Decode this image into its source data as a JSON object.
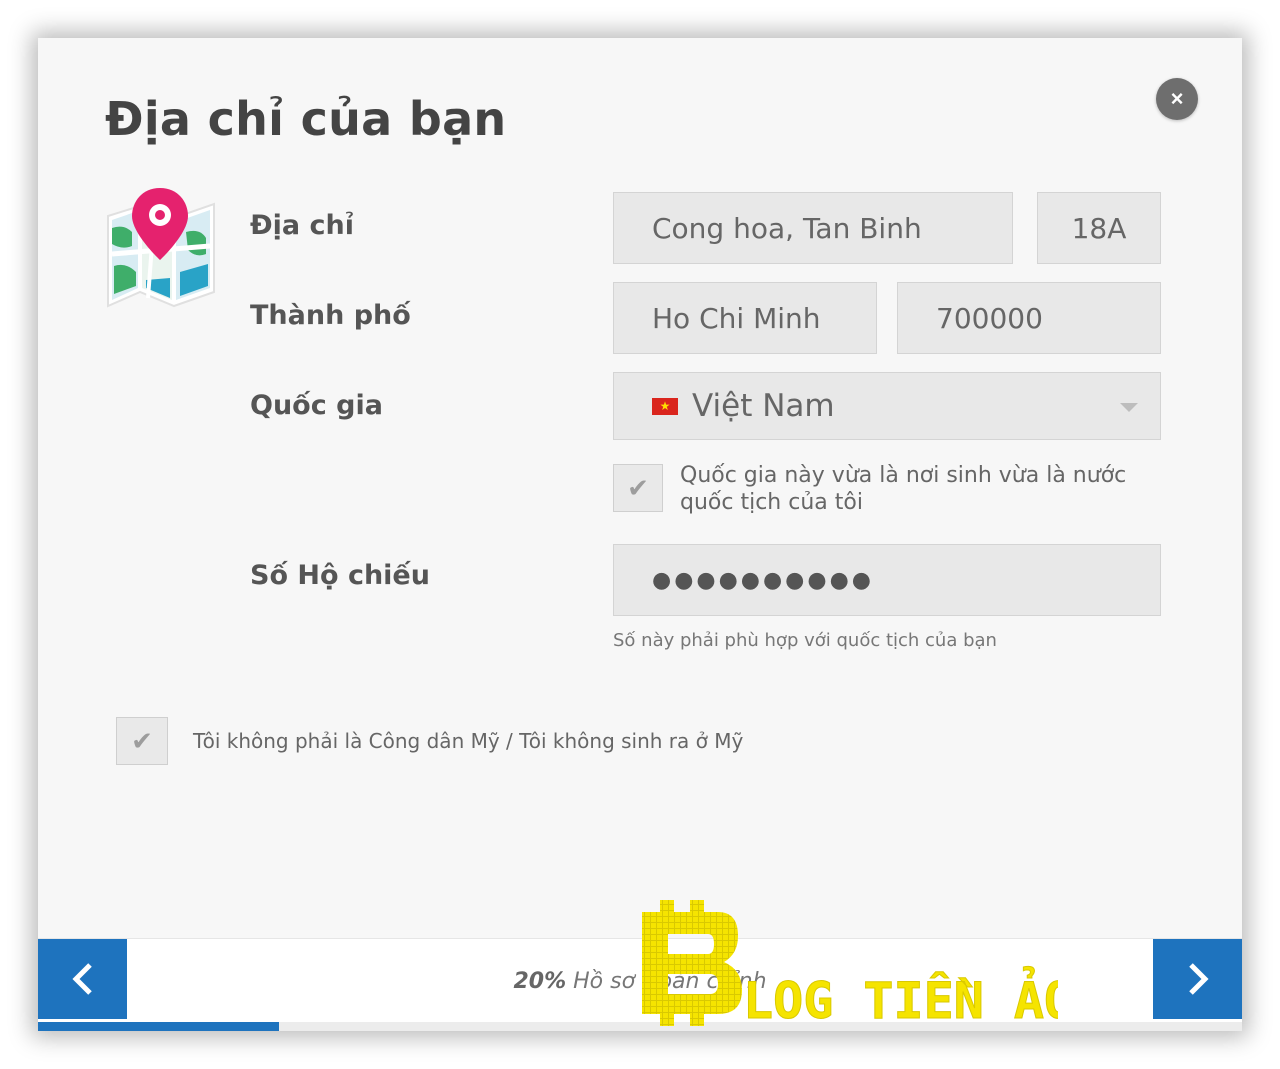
{
  "dialog": {
    "title": "Địa chỉ của bạn",
    "close_symbol": "×",
    "icons": {
      "map": "map-pin-icon",
      "close": "close-icon"
    }
  },
  "address": {
    "label": "Địa chỉ",
    "street_value": "Cong hoa, Tan Binh",
    "number_value": "18A"
  },
  "city": {
    "label": "Thành phố",
    "city_value": "Ho Chi Minh",
    "postal_value": "700000"
  },
  "country": {
    "label": "Quốc gia",
    "selected": "Việt Nam",
    "flag_icon": "vietnam-flag-icon",
    "checkbox_checked": true,
    "checkbox_label_line1": "Quốc gia này vừa là nơi sinh vừa là nước",
    "checkbox_label_line2": "quốc tịch của tôi"
  },
  "passport": {
    "label": "Số Hộ chiếu",
    "masked_value": "●●●●●●●●●●",
    "hint": "Số này phải phù hợp với quốc tịch của bạn"
  },
  "us_citizen": {
    "checkbox_checked": true,
    "label": "Tôi không phải là Công dân Mỹ / Tôi không sinh ra ở Mỹ"
  },
  "footer": {
    "progress_percent": "20%",
    "progress_fraction": 0.2,
    "progress_label": "Hồ sơ Hoàn chỉnh",
    "prev_icon": "chevron-left-icon",
    "next_icon": "chevron-right-icon"
  },
  "watermark": {
    "text": "BLOG TIỀN ẢO",
    "color": "#f5e400"
  },
  "colors": {
    "accent": "#1e73be",
    "pin": "#e5226e",
    "field_bg": "#e8e8e8"
  }
}
